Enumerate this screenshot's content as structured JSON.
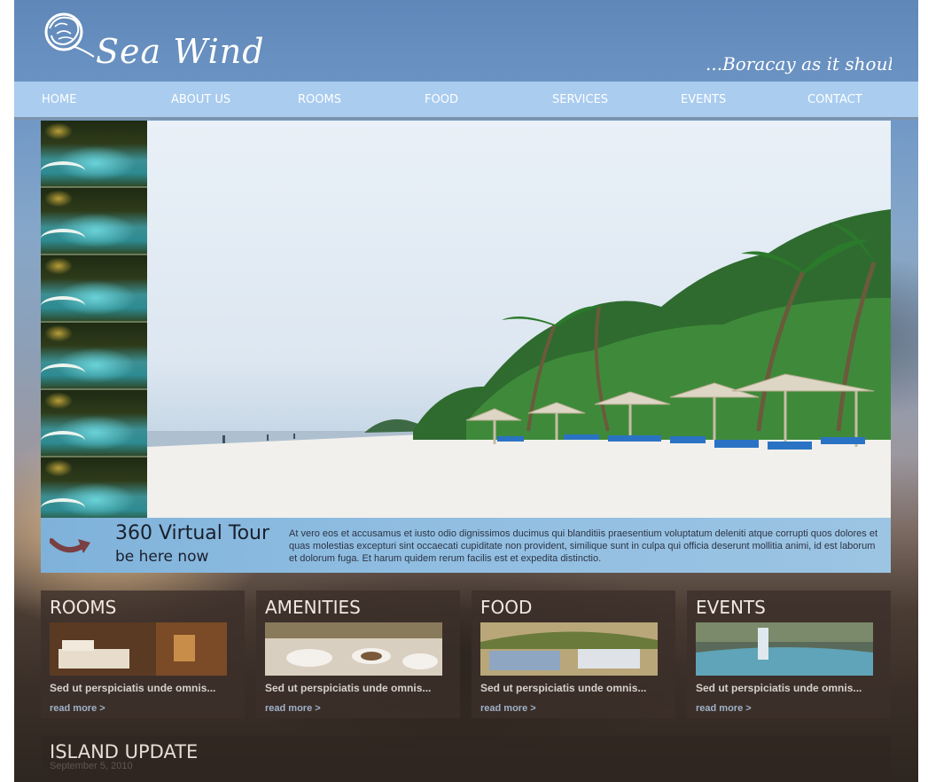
{
  "brand": {
    "name": "Sea Wind",
    "tagline": "...Boracay as it should be"
  },
  "nav": {
    "items": [
      "HOME",
      "ABOUT US",
      "ROOMS",
      "FOOD",
      "SERVICES",
      "EVENTS",
      "CONTACT"
    ]
  },
  "tour": {
    "title": "360 Virtual Tour",
    "subtitle": "be here now",
    "description": "At vero eos et accusamus et iusto odio dignissimos ducimus qui blanditiis praesentium voluptatum deleniti atque corrupti quos dolores et quas molestias excepturi sint occaecati cupiditate non provident, similique sunt in culpa qui officia deserunt mollitia animi, id est laborum et dolorum fuga. Et harum quidem rerum facilis est et expedita distinctio."
  },
  "cards": [
    {
      "title": "ROOMS",
      "text": "Sed ut perspiciatis unde omnis...",
      "link": "read more >"
    },
    {
      "title": "AMENITIES",
      "text": "Sed ut perspiciatis unde omnis...",
      "link": "read more >"
    },
    {
      "title": "FOOD",
      "text": "Sed ut perspiciatis unde omnis...",
      "link": "read more >"
    },
    {
      "title": "EVENTS",
      "text": "Sed ut perspiciatis unde omnis...",
      "link": "read more >"
    }
  ],
  "island_update": {
    "title": "ISLAND UPDATE",
    "date": "September 5, 2010"
  },
  "colors": {
    "nav_bg": "#a9ccef",
    "card_bg": "#3c302a",
    "link": "#9fb2c9",
    "tour_arrow": "#7a3f42"
  },
  "icons": {
    "logo": "sea-wind-logo-icon",
    "tour_arrow": "curved-arrow-icon"
  }
}
